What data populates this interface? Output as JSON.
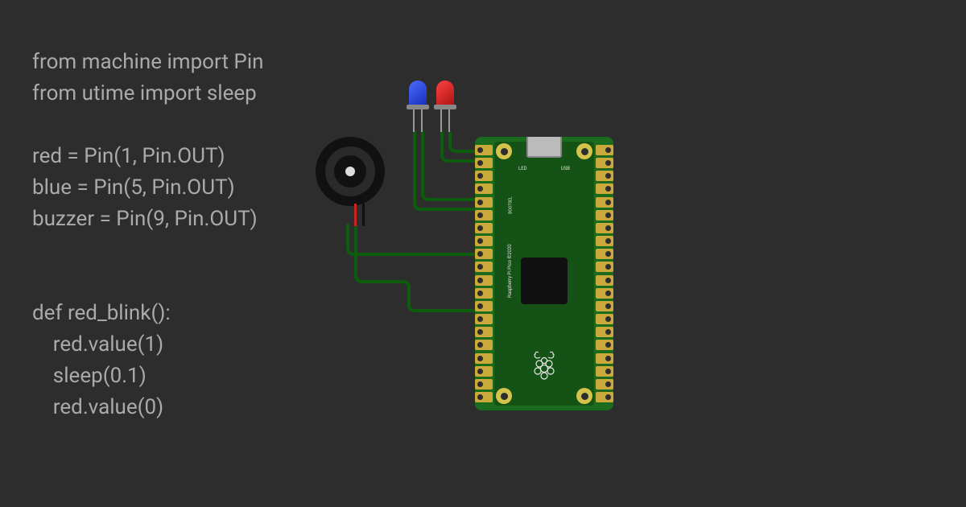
{
  "code": {
    "lines": [
      "from machine import Pin",
      "from utime import sleep",
      "",
      "red = Pin(1, Pin.OUT)",
      "blue = Pin(5, Pin.OUT)",
      "buzzer = Pin(9, Pin.OUT)",
      "",
      "",
      "def red_blink():",
      "    red.value(1)",
      "    sleep(0.1)",
      "    red.value(0)"
    ]
  },
  "board": {
    "name": "Raspberry Pi Pico",
    "copyright": "Raspberry Pi Pico ©2020",
    "label_led": "LED",
    "label_usb": "USB",
    "label_bootsel": "BOOTSEL",
    "pins_per_side": 20
  },
  "components": {
    "buzzer": {
      "type": "piezo-buzzer",
      "pin": 9
    },
    "led_blue": {
      "type": "led",
      "color": "#2a4fff",
      "pin": 5
    },
    "led_red": {
      "type": "led",
      "color": "#e02222",
      "pin": 1
    }
  },
  "colors": {
    "wire": "#0d5b0d",
    "bg": "#2d2d2d",
    "code_text": "#aaaaaa",
    "pcb": "#1a6b1e"
  }
}
